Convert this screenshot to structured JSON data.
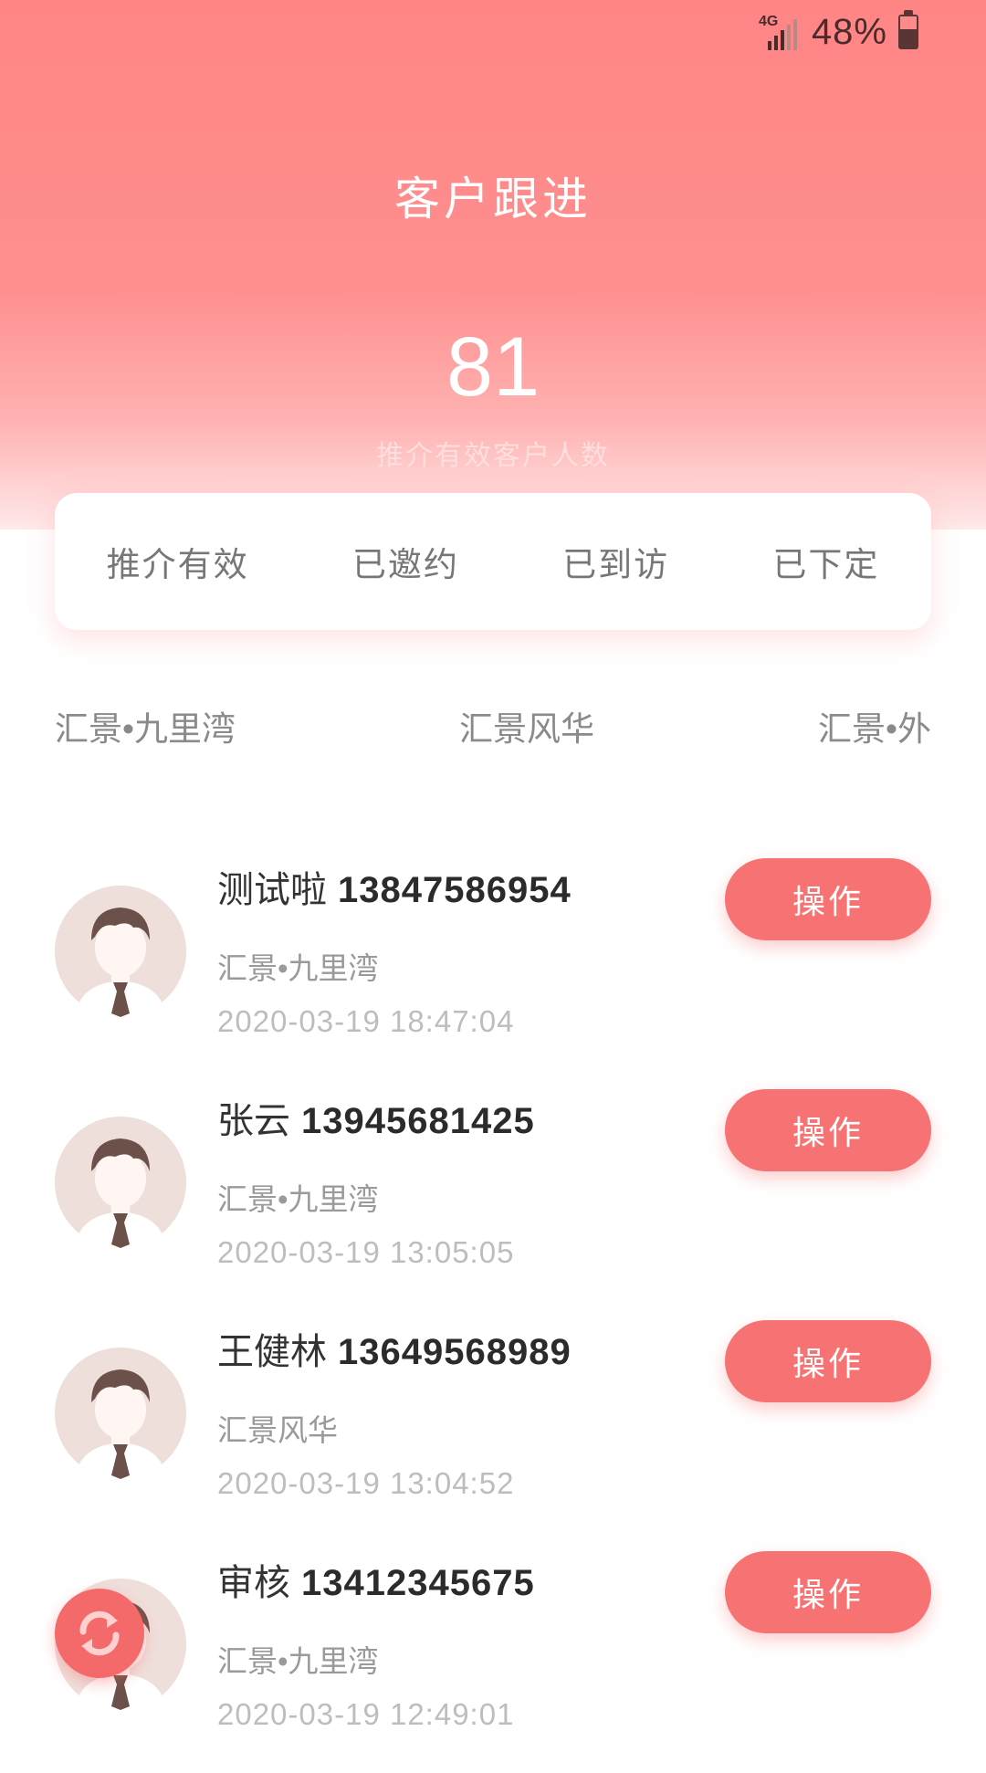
{
  "status_bar": {
    "network": "4G",
    "battery_percent": "48%"
  },
  "header": {
    "title": "客户跟进",
    "count": "81",
    "count_label": "推介有效客户人数"
  },
  "status_tabs": [
    "推介有效",
    "已邀约",
    "已到访",
    "已下定"
  ],
  "project_tabs": [
    "汇景•九里湾",
    "汇景风华",
    "汇景•外"
  ],
  "customers": [
    {
      "name": "测试啦",
      "phone": "13847586954",
      "project": "汇景•九里湾",
      "time": "2020-03-19 18:47:04",
      "action": "操作"
    },
    {
      "name": "张云",
      "phone": "13945681425",
      "project": "汇景•九里湾",
      "time": "2020-03-19 13:05:05",
      "action": "操作"
    },
    {
      "name": "王健林",
      "phone": "13649568989",
      "project": "汇景风华",
      "time": "2020-03-19 13:04:52",
      "action": "操作"
    },
    {
      "name": "审核",
      "phone": "13412345675",
      "project": "汇景•九里湾",
      "time": "2020-03-19 12:49:01",
      "action": "操作"
    }
  ],
  "colors": {
    "accent": "#f77272",
    "header_top": "#ff8585"
  },
  "icons": {
    "fab": "refresh-icon",
    "avatar": "user-avatar-icon"
  }
}
